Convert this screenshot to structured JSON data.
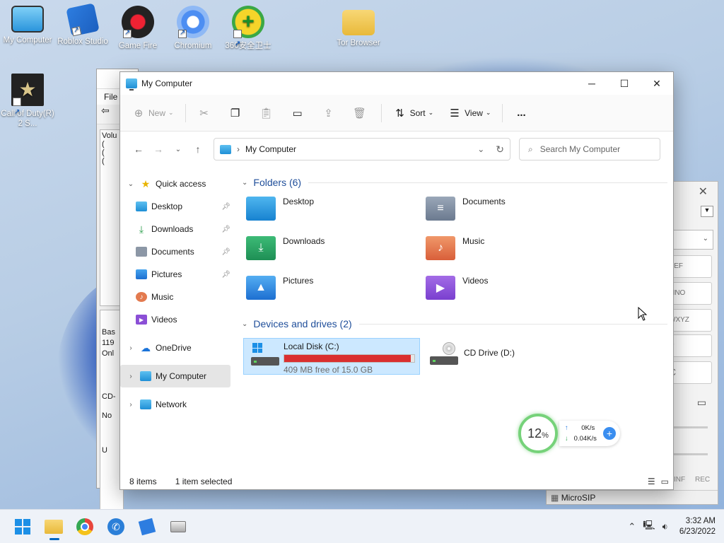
{
  "desktop": {
    "icons": [
      {
        "label": "My Computer"
      },
      {
        "label": "Roblox Studio"
      },
      {
        "label": "Game Fire"
      },
      {
        "label": "Chromium"
      },
      {
        "label": "360安全卫士"
      },
      {
        "label": "Tor Browser"
      },
      {
        "label": "Call of Duty(R) 2 S..."
      }
    ]
  },
  "back_window": {
    "menu_file": "File",
    "list_header": "Volu",
    "list_rows": [
      "(",
      "(",
      "("
    ],
    "lower_lines": [
      "Bas",
      "119",
      "Onl"
    ],
    "cd_lines": [
      "CD-",
      "No"
    ],
    "bottom": "U"
  },
  "microsip": {
    "keys": [
      "DEF",
      "MNO",
      "WXYZ",
      "#",
      "C"
    ],
    "footer": [
      "INF",
      "REC"
    ],
    "status": "MicroSIP"
  },
  "explorer": {
    "title": "My Computer",
    "commands": {
      "new": "New",
      "sort": "Sort",
      "view": "View",
      "more": "..."
    },
    "address": "My Computer",
    "search_placeholder": "Search My Computer",
    "nav": {
      "quick_access": "Quick access",
      "desktop": "Desktop",
      "downloads": "Downloads",
      "documents": "Documents",
      "pictures": "Pictures",
      "music": "Music",
      "videos": "Videos",
      "onedrive": "OneDrive",
      "mycomputer": "My Computer",
      "network": "Network"
    },
    "folders_header": "Folders (6)",
    "folders": [
      {
        "name": "Desktop"
      },
      {
        "name": "Documents"
      },
      {
        "name": "Downloads"
      },
      {
        "name": "Music"
      },
      {
        "name": "Pictures"
      },
      {
        "name": "Videos"
      }
    ],
    "drives_header": "Devices and drives (2)",
    "drives": [
      {
        "name": "Local Disk (C:)",
        "free": "409 MB free of 15.0 GB",
        "used_fraction": 0.973
      },
      {
        "name": "CD Drive (D:)"
      }
    ],
    "status_items": "8 items",
    "status_selected": "1 item selected"
  },
  "net_widget": {
    "percent": "12",
    "percent_sign": "%",
    "up": "0K/s",
    "down": "0.04K/s"
  },
  "taskbar": {
    "time": "3:32 AM",
    "date": "6/23/2022"
  },
  "colors": {
    "accent": "#0067c0",
    "disk_full": "#da2f2f",
    "selected": "#cce8ff"
  }
}
